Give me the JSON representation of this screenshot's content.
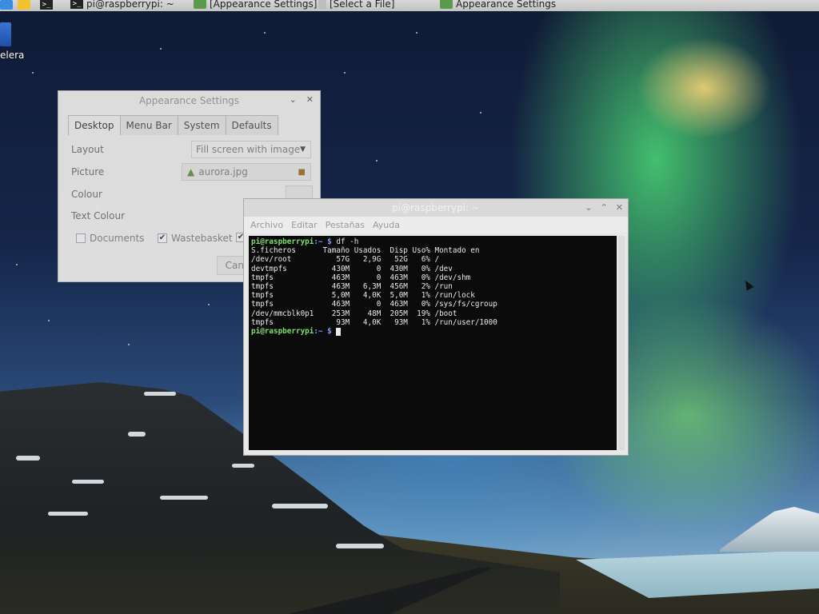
{
  "taskbar": {
    "items": [
      {
        "label": "pi@raspberrypi: ~"
      },
      {
        "label": "[Appearance Settings]"
      },
      {
        "label": "[Select a File]"
      },
      {
        "label": "Appearance Settings"
      }
    ]
  },
  "desktop": {
    "icon_label": "elera"
  },
  "appearance": {
    "title": "Appearance Settings",
    "tabs": [
      "Desktop",
      "Menu Bar",
      "System",
      "Defaults"
    ],
    "layout_label": "Layout",
    "layout_value": "Fill screen with image",
    "picture_label": "Picture",
    "picture_value": "aurora.jpg",
    "colour_label": "Colour",
    "text_colour_label": "Text Colour",
    "documents_label": "Documents",
    "wastebasket_label": "Wastebasket",
    "cancel_label": "Cancel"
  },
  "terminal": {
    "title": "pi@raspberrypi: ~",
    "menu": [
      "Archivo",
      "Editar",
      "Pestañas",
      "Ayuda"
    ],
    "prompt_user": "pi@raspberrypi",
    "prompt_path": ":~ $",
    "command": " df -h",
    "header": "S.ficheros      Tamaño Usados  Disp Uso% Montado en",
    "rows": [
      "/dev/root          57G   2,9G   52G   6% /",
      "devtmpfs          430M      0  430M   0% /dev",
      "tmpfs             463M      0  463M   0% /dev/shm",
      "tmpfs             463M   6,3M  456M   2% /run",
      "tmpfs             5,0M   4,0K  5,0M   1% /run/lock",
      "tmpfs             463M      0  463M   0% /sys/fs/cgroup",
      "/dev/mmcblk0p1    253M    48M  205M  19% /boot",
      "tmpfs              93M   4,0K   93M   1% /run/user/1000"
    ]
  },
  "icons": {
    "window_controls": [
      "minimize-icon",
      "maximize-icon",
      "close-icon"
    ],
    "folder": "folder-icon",
    "image": "image-file-icon"
  }
}
